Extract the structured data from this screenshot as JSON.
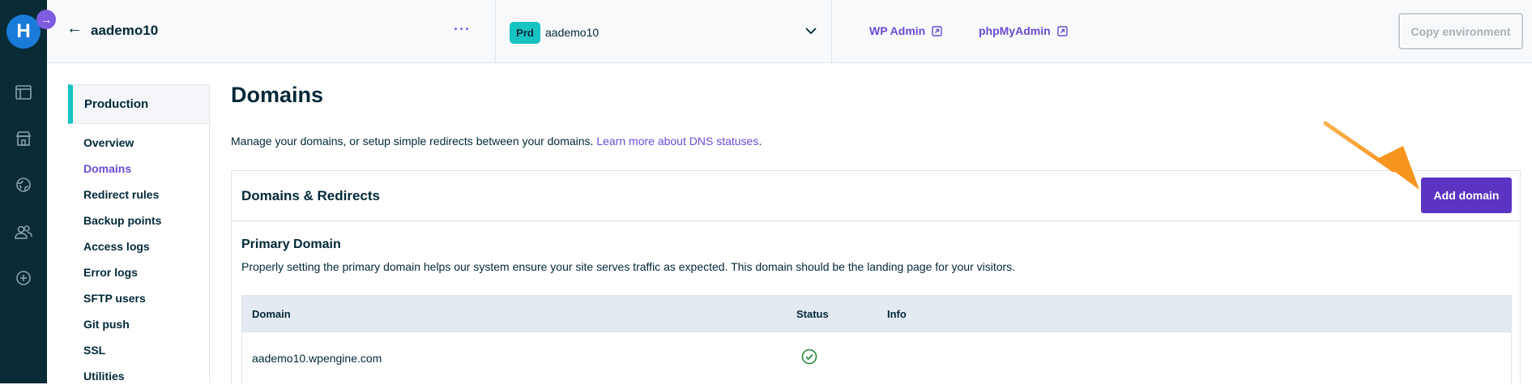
{
  "topbar": {
    "site_name": "aademo10",
    "env_badge": "Prd",
    "env_name": "aademo10",
    "links": [
      {
        "label": "WP Admin"
      },
      {
        "label": "phpMyAdmin"
      }
    ],
    "copy_label": "Copy environment"
  },
  "rail": {
    "logo_letter": "H",
    "icons": [
      "sites-icon",
      "store-icon",
      "globe-icon",
      "users-icon",
      "add-icon"
    ]
  },
  "sidebar": {
    "env_label": "Production",
    "items": [
      {
        "label": "Overview"
      },
      {
        "label": "Domains"
      },
      {
        "label": "Redirect rules"
      },
      {
        "label": "Backup points"
      },
      {
        "label": "Access logs"
      },
      {
        "label": "Error logs"
      },
      {
        "label": "SFTP users"
      },
      {
        "label": "Git push"
      },
      {
        "label": "SSL"
      },
      {
        "label": "Utilities"
      }
    ],
    "active_index": 1
  },
  "main": {
    "title": "Domains",
    "description": "Manage your domains, or setup simple redirects between your domains.",
    "description_link": "Learn more about DNS statuses",
    "description_end": ".",
    "panel_title": "Domains & Redirects",
    "add_button": "Add domain",
    "primary_title": "Primary Domain",
    "primary_desc": "Properly setting the primary domain helps our system ensure your site serves traffic as expected. This domain should be the landing page for your visitors.",
    "table": {
      "headers": [
        "Domain",
        "Status",
        "Info"
      ],
      "rows": [
        {
          "domain": "aademo10.wpengine.com",
          "status": "ok",
          "info": ""
        }
      ]
    }
  },
  "colors": {
    "accent": "#6b4bd6",
    "primary_button": "#5b34c4",
    "env_badge": "#17c3c3",
    "rail": "#082b36",
    "annotation_arrow": "#f7941d"
  }
}
